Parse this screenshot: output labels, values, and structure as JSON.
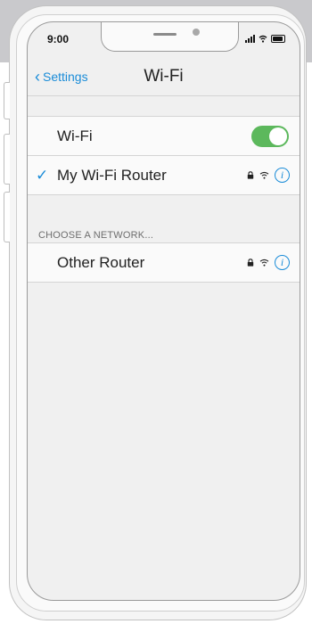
{
  "status_bar": {
    "time": "9:00"
  },
  "nav": {
    "back_label": "Settings",
    "title": "Wi-Fi"
  },
  "wifi_toggle": {
    "label": "Wi-Fi",
    "enabled": true
  },
  "connected_network": {
    "name": "My Wi-Fi Router",
    "secured": true
  },
  "section_header": "CHOOSE A NETWORK...",
  "networks": [
    {
      "name": "Other Router",
      "secured": true
    }
  ],
  "colors": {
    "accent": "#1a8cd8",
    "toggle_on": "#5cb85c"
  },
  "icons": [
    "lock-icon",
    "wifi-icon",
    "info-icon",
    "checkmark-icon",
    "back-chevron-icon",
    "battery-icon",
    "signal-icon"
  ]
}
